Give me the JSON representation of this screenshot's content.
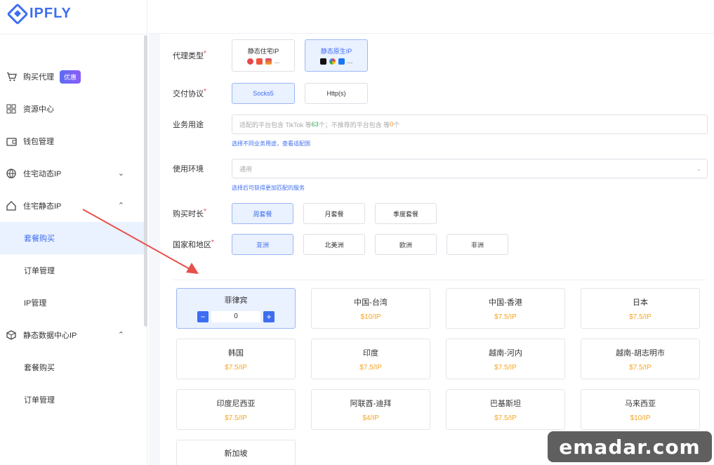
{
  "brand": {
    "name": "IPFLY"
  },
  "sidebar": {
    "items": [
      {
        "label": "购买代理",
        "icon": "cart-icon",
        "badge": "优惠"
      },
      {
        "label": "资源中心",
        "icon": "grid-icon"
      },
      {
        "label": "钱包管理",
        "icon": "wallet-icon"
      },
      {
        "label": "住宅动态IP",
        "icon": "globe-icon",
        "chevron": "⌄"
      },
      {
        "label": "住宅静态IP",
        "icon": "home-icon",
        "chevron": "⌃"
      },
      {
        "label": "套餐购买",
        "sub": true,
        "active": true
      },
      {
        "label": "订单管理",
        "sub": true
      },
      {
        "label": "IP管理",
        "sub": true
      },
      {
        "label": "静态数据中心IP",
        "icon": "server-icon",
        "chevron": "⌃"
      },
      {
        "label": "套餐购买",
        "sub": true
      },
      {
        "label": "订单管理",
        "sub": true
      }
    ]
  },
  "form": {
    "proxy_type": {
      "label": "代理类型",
      "options": [
        {
          "name": "静态住宅IP",
          "selected": false
        },
        {
          "name": "静态原生IP",
          "selected": true
        }
      ],
      "more": "..."
    },
    "protocol": {
      "label": "交付协议",
      "options": [
        "Socks5",
        "Http(s)"
      ],
      "selected": "Socks5"
    },
    "usage": {
      "label": "业务用途",
      "placeholder_a": "适配的平台包含 TikTok 等 ",
      "count_green": "63",
      "placeholder_b": "个；不推荐的平台包含 等 ",
      "count_orange": "0",
      "placeholder_c": "个",
      "hint": "选择不同业务用途，查看适配国"
    },
    "environment": {
      "label": "使用环境",
      "value": "通用",
      "hint": "选择后可获得更加匹配的服务"
    },
    "duration": {
      "label": "购买时长",
      "options": [
        "周套餐",
        "月套餐",
        "季度套餐"
      ],
      "selected": "周套餐"
    },
    "region": {
      "label": "国家和地区",
      "options": [
        "亚洲",
        "北美洲",
        "欧洲",
        "非洲"
      ],
      "selected": "亚洲"
    }
  },
  "countries": [
    {
      "name": "菲律宾",
      "selected": true,
      "quantity": "0"
    },
    {
      "name": "中国-台湾",
      "price": "$10/IP"
    },
    {
      "name": "中国-香港",
      "price": "$7.5/IP"
    },
    {
      "name": "日本",
      "price": "$7.5/IP"
    },
    {
      "name": "韩国",
      "price": "$7.5/IP"
    },
    {
      "name": "印度",
      "price": "$7.5/IP"
    },
    {
      "name": "越南-河内",
      "price": "$7.5/IP"
    },
    {
      "name": "越南-胡志明市",
      "price": "$7.5/IP"
    },
    {
      "name": "印度尼西亚",
      "price": "$7.5/IP"
    },
    {
      "name": "阿联酋-迪拜",
      "price": "$4/IP"
    },
    {
      "name": "巴基斯坦",
      "price": "$7.5/IP"
    },
    {
      "name": "马来西亚",
      "price": "$10/IP"
    },
    {
      "name": "新加坡",
      "price": ""
    }
  ],
  "stepper": {
    "minus": "−",
    "plus": "+"
  },
  "watermark": {
    "text": "emadar.com"
  },
  "colors": {
    "accent": "#3d6df0",
    "price": "#f5a623",
    "arrow": "#e8504a",
    "required": "#e5484d"
  }
}
